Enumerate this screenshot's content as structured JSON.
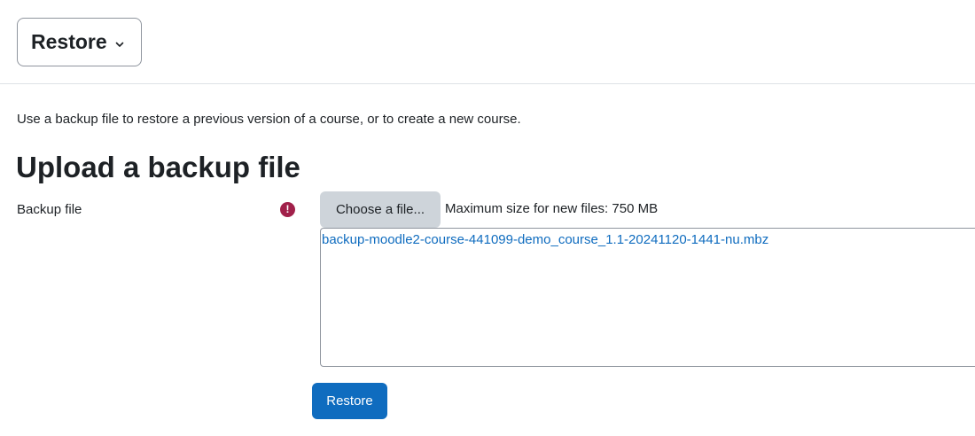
{
  "nav": {
    "dropdown_label": "Restore",
    "chevron_icon": "chevron-down-icon"
  },
  "intro": {
    "text": "Use a backup file to restore a previous version of a course, or to create a new course."
  },
  "upload": {
    "heading": "Upload a backup file",
    "field_label": "Backup file",
    "required_icon": "required-exclamation-icon",
    "required_glyph": "!",
    "choose_button": "Choose a file...",
    "max_size_text": "Maximum size for new files: 750 MB",
    "selected_file": "backup-moodle2-course-441099-demo_course_1.1-20241120-1441-nu.mbz"
  },
  "actions": {
    "restore_button": "Restore"
  },
  "colors": {
    "primary": "#0f6cbf",
    "required": "#a1204a",
    "secondary_button": "#ced4da",
    "text": "#1d2125"
  }
}
